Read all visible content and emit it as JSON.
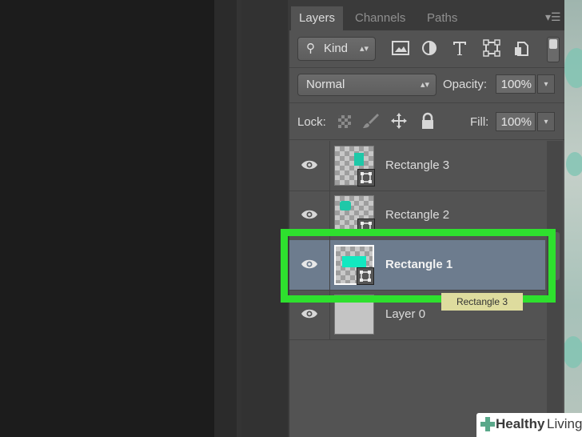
{
  "tabs": [
    {
      "label": "Layers",
      "active": true
    },
    {
      "label": "Channels",
      "active": false
    },
    {
      "label": "Paths",
      "active": false
    }
  ],
  "filter": {
    "kind_label": "Kind",
    "icons": [
      "image-filter-icon",
      "adjustment-filter-icon",
      "type-filter-icon",
      "shape-filter-icon",
      "smart-object-filter-icon"
    ]
  },
  "blend": {
    "mode": "Normal",
    "opacity_label": "Opacity:",
    "opacity_value": "100%"
  },
  "lock": {
    "label": "Lock:",
    "fill_label": "Fill:",
    "fill_value": "100%"
  },
  "layers": [
    {
      "name": "Rectangle 3",
      "selected": false,
      "visible": true
    },
    {
      "name": "Rectangle 2",
      "selected": false,
      "visible": true
    },
    {
      "name": "Rectangle 1",
      "selected": true,
      "visible": true
    },
    {
      "name": "Layer 0",
      "selected": false,
      "visible": true
    }
  ],
  "drag_tooltip": "Rectangle 3",
  "watermark": {
    "brand1": "Healthy",
    "brand2": "Living"
  },
  "colors": {
    "highlight": "#2ee02e",
    "shape_teal": "#1ec8a8",
    "selected_row": "#6d7c8e"
  }
}
